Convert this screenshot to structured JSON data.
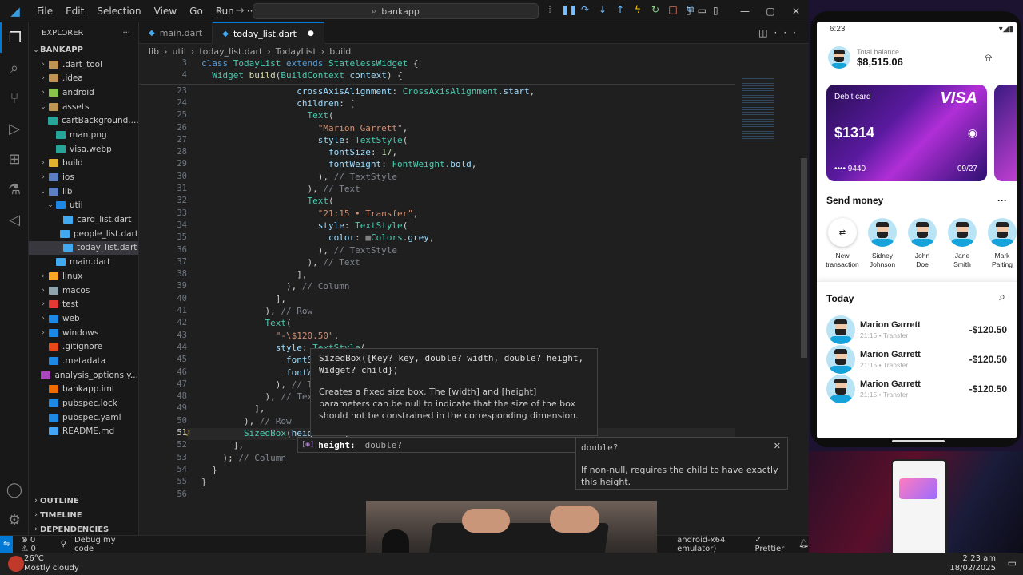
{
  "titlebar": {
    "menu": [
      "File",
      "Edit",
      "Selection",
      "View",
      "Go",
      "Run",
      "···"
    ],
    "search": "bankapp"
  },
  "explorer": {
    "header": "EXPLORER",
    "root": "BANKAPP",
    "tree": [
      {
        "label": ".dart_tool",
        "depth": 1,
        "chevron": "›",
        "color": "#c09553"
      },
      {
        "label": ".idea",
        "depth": 1,
        "chevron": "›",
        "color": "#c09553"
      },
      {
        "label": "android",
        "depth": 1,
        "chevron": "›",
        "color": "#8bc34a"
      },
      {
        "label": "assets",
        "depth": 1,
        "chevron": "⌄",
        "color": "#c09553"
      },
      {
        "label": "cartBackground....",
        "depth": 2,
        "chevron": "",
        "color": "#26a69a"
      },
      {
        "label": "man.png",
        "depth": 2,
        "chevron": "",
        "color": "#26a69a"
      },
      {
        "label": "visa.webp",
        "depth": 2,
        "chevron": "",
        "color": "#26a69a"
      },
      {
        "label": "build",
        "depth": 1,
        "chevron": "›",
        "color": "#e2b02f"
      },
      {
        "label": "ios",
        "depth": 1,
        "chevron": "›",
        "color": "#5c7ec4"
      },
      {
        "label": "lib",
        "depth": 1,
        "chevron": "⌄",
        "color": "#5c7ec4"
      },
      {
        "label": "util",
        "depth": 2,
        "chevron": "⌄",
        "color": "#1e88e5"
      },
      {
        "label": "card_list.dart",
        "depth": 3,
        "chevron": "",
        "color": "#40a9f0"
      },
      {
        "label": "people_list.dart",
        "depth": 3,
        "chevron": "",
        "color": "#40a9f0"
      },
      {
        "label": "today_list.dart",
        "depth": 3,
        "chevron": "",
        "color": "#40a9f0",
        "selected": true
      },
      {
        "label": "main.dart",
        "depth": 2,
        "chevron": "",
        "color": "#40a9f0"
      },
      {
        "label": "linux",
        "depth": 1,
        "chevron": "›",
        "color": "#f9a825"
      },
      {
        "label": "macos",
        "depth": 1,
        "chevron": "›",
        "color": "#90a4ae"
      },
      {
        "label": "test",
        "depth": 1,
        "chevron": "›",
        "color": "#e53935"
      },
      {
        "label": "web",
        "depth": 1,
        "chevron": "›",
        "color": "#1e88e5"
      },
      {
        "label": "windows",
        "depth": 1,
        "chevron": "›",
        "color": "#1e88e5"
      },
      {
        "label": ".gitignore",
        "depth": 1,
        "chevron": "",
        "color": "#e64a19"
      },
      {
        "label": ".metadata",
        "depth": 1,
        "chevron": "",
        "color": "#1e88e5"
      },
      {
        "label": "analysis_options.y...",
        "depth": 1,
        "chevron": "",
        "color": "#ab47bc"
      },
      {
        "label": "bankapp.iml",
        "depth": 1,
        "chevron": "",
        "color": "#ef6c00"
      },
      {
        "label": "pubspec.lock",
        "depth": 1,
        "chevron": "",
        "color": "#1e88e5"
      },
      {
        "label": "pubspec.yaml",
        "depth": 1,
        "chevron": "",
        "color": "#1e88e5"
      },
      {
        "label": "README.md",
        "depth": 1,
        "chevron": "",
        "color": "#42a5f5"
      }
    ],
    "outline": "OUTLINE",
    "timeline": "TIMELINE",
    "dependencies": "DEPENDENCIES"
  },
  "tabs": [
    {
      "label": "main.dart",
      "active": false
    },
    {
      "label": "today_list.dart",
      "active": true,
      "dirty": "●"
    }
  ],
  "breadcrumb": [
    "lib",
    "›",
    "util",
    "›",
    "today_list.dart",
    "›",
    "TodayList",
    "›",
    "build"
  ],
  "code": {
    "sticky": [
      {
        "n": "3",
        "html": "<span class='k'>class</span> <span class='c'>TodayList</span> <span class='k'>extends</span> <span class='c'>StatelessWidget</span> {"
      },
      {
        "n": "4",
        "html": "  <span class='c'>Widget</span> <span class='m'>build</span>(<span class='c'>BuildContext</span> <span class='p'>context</span>) {"
      }
    ],
    "lines": [
      {
        "n": "23",
        "html": "                  <span class='p'>crossAxisAlignment</span>: <span class='c'>CrossAxisAlignment</span>.<span class='p'>start</span>,"
      },
      {
        "n": "24",
        "html": "                  <span class='p'>children</span>: ["
      },
      {
        "n": "25",
        "html": "                    <span class='c'>Text</span>("
      },
      {
        "n": "26",
        "html": "                      <span class='s'>\"Marion Garrett\"</span>,"
      },
      {
        "n": "27",
        "html": "                      <span class='p'>style</span>: <span class='c'>TextStyle</span>("
      },
      {
        "n": "28",
        "html": "                        <span class='p'>fontSize</span>: <span class='n'>17</span>,"
      },
      {
        "n": "29",
        "html": "                        <span class='p'>fontWeight</span>: <span class='c'>FontWeight</span>.<span class='p'>bold</span>,"
      },
      {
        "n": "30",
        "html": "                      ), <span class='cm'>// TextStyle</span>"
      },
      {
        "n": "31",
        "html": "                    ), <span class='cm'>// Text</span>"
      },
      {
        "n": "32",
        "html": "                    <span class='c'>Text</span>("
      },
      {
        "n": "33",
        "html": "                      <span class='s'>\"21:15 • Transfer\"</span>,"
      },
      {
        "n": "34",
        "html": "                      <span class='p'>style</span>: <span class='c'>TextStyle</span>("
      },
      {
        "n": "35",
        "html": "                        <span class='p'>color</span>: <span style='color:#808080'>■</span><span class='c'>Colors</span>.<span class='p'>grey</span>,"
      },
      {
        "n": "36",
        "html": "                      ), <span class='cm'>// TextStyle</span>"
      },
      {
        "n": "37",
        "html": "                    ), <span class='cm'>// Text</span>"
      },
      {
        "n": "38",
        "html": "                  ],"
      },
      {
        "n": "39",
        "html": "                ), <span class='cm'>// Column</span>"
      },
      {
        "n": "40",
        "html": "              ],"
      },
      {
        "n": "41",
        "html": "            ), <span class='cm'>// Row</span>"
      },
      {
        "n": "42",
        "html": "            <span class='c'>Text</span>("
      },
      {
        "n": "43",
        "html": "              <span class='s'>\"-\\$120.50\"</span>,"
      },
      {
        "n": "44",
        "html": "              <span class='p'>style</span>: <span class='c'>TextStyle</span>("
      },
      {
        "n": "45",
        "html": "                <span class='p'>fontSize</span>: <span class='n'>2</span>"
      },
      {
        "n": "46",
        "html": "                <span class='p'>fontWeight</span>:"
      },
      {
        "n": "47",
        "html": "              ), <span class='cm'>// TextSty</span>"
      },
      {
        "n": "48",
        "html": "            ), <span class='cm'>// Text</span>"
      },
      {
        "n": "49",
        "html": "          ],"
      },
      {
        "n": "50",
        "html": "        ), <span class='cm'>// Row</span>"
      },
      {
        "n": "51",
        "html": "        <span class='c'>SizedBox</span>(<span class='p'>height</span>: <span class='n'>10</span>)",
        "current": true
      },
      {
        "n": "52",
        "html": "      ],"
      },
      {
        "n": "53",
        "html": "    ); <span class='cm'>// Column</span>"
      },
      {
        "n": "54",
        "html": "  }"
      },
      {
        "n": "55",
        "html": "}"
      },
      {
        "n": "56",
        "html": ""
      }
    ]
  },
  "hover": {
    "signature": "SizedBox({Key? key, double? width, double? height,\nWidget? child})",
    "doc": "Creates a fixed size box. The [width] and [height] parameters can be null to indicate that the size of the box should not be constrained in the corresponding dimension."
  },
  "suggest": {
    "label": "height:",
    "type": "double?"
  },
  "suggest_detail": {
    "type": "double?",
    "doc": "If non-null, requires the child to have exactly this height.",
    "close": "✕"
  },
  "statusbar": {
    "errors": "⊗ 0 ⚠ 0",
    "debug": "Debug my code",
    "device": "android-x64 emulator)",
    "prettier": "✓ Prettier"
  },
  "taskbar": {
    "weather_temp": "26°C",
    "weather_desc": "Mostly cloudy",
    "time": "2:23 am",
    "date": "18/02/2025"
  },
  "phone": {
    "time": "6:23",
    "balance_label": "Total balance",
    "balance": "$8,515.06",
    "card_label": "Debit card",
    "card_brand": "VISA",
    "card_amount": "$1314",
    "card_number": "•••• 9440",
    "card_expiry": "09/27",
    "send_title": "Send money",
    "send_more": "···",
    "contacts": [
      {
        "name": "New\ntransaction",
        "new": true
      },
      {
        "name": "Sidney\nJohnson"
      },
      {
        "name": "John\nDoe"
      },
      {
        "name": "Jane\nSmith"
      },
      {
        "name": "Mark\nPalting"
      }
    ],
    "today_title": "Today",
    "transactions": [
      {
        "name": "Marion Garrett",
        "sub": "21:15 • Transfer",
        "amount": "-$120.50"
      },
      {
        "name": "Marion Garrett",
        "sub": "21:15 • Transfer",
        "amount": "-$120.50"
      },
      {
        "name": "Marion Garrett",
        "sub": "21:15 • Transfer",
        "amount": "-$120.50"
      }
    ]
  }
}
